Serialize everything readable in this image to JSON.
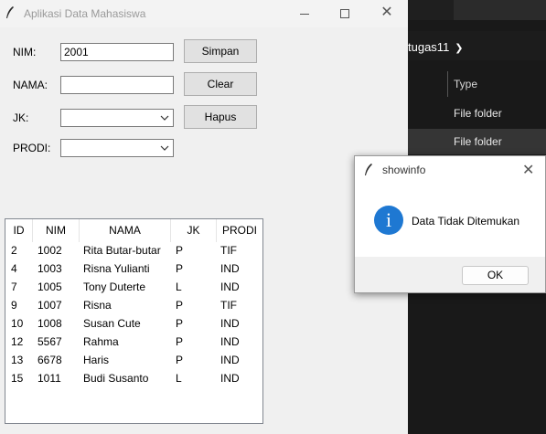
{
  "window": {
    "title": "Aplikasi Data Mahasiswa"
  },
  "form": {
    "nim_label": "NIM:",
    "nim_value": "2001",
    "nama_label": "NAMA:",
    "nama_value": "",
    "jk_label": "JK:",
    "jk_value": "",
    "prodi_label": "PRODI:",
    "prodi_value": ""
  },
  "buttons": {
    "simpan": "Simpan",
    "clear": "Clear",
    "hapus": "Hapus"
  },
  "table": {
    "columns": [
      "ID",
      "NIM",
      "NAMA",
      "JK",
      "PRODI"
    ],
    "rows": [
      [
        "2",
        "1002",
        "Rita Butar-butar",
        "P",
        "TIF"
      ],
      [
        "4",
        "1003",
        "Risna Yulianti",
        "P",
        "IND"
      ],
      [
        "7",
        "1005",
        "Tony Duterte",
        "L",
        "IND"
      ],
      [
        "9",
        "1007",
        "Risna",
        "P",
        "TIF"
      ],
      [
        "10",
        "1008",
        "Susan Cute",
        "P",
        "IND"
      ],
      [
        "12",
        "5567",
        "Rahma",
        "P",
        "IND"
      ],
      [
        "13",
        "6678",
        "Haris",
        "P",
        "IND"
      ],
      [
        "15",
        "1011",
        "Budi Susanto",
        "L",
        "IND"
      ]
    ]
  },
  "dialog": {
    "title": "showinfo",
    "message": "Data Tidak Ditemukan",
    "ok_label": "OK",
    "icon": "info-icon"
  },
  "explorer": {
    "breadcrumb": "tugas11",
    "column_type": "Type",
    "rows": [
      "File folder",
      "File folder"
    ]
  },
  "colors": {
    "info_blue": "#1e78d2",
    "explorer_bg": "#191919"
  }
}
